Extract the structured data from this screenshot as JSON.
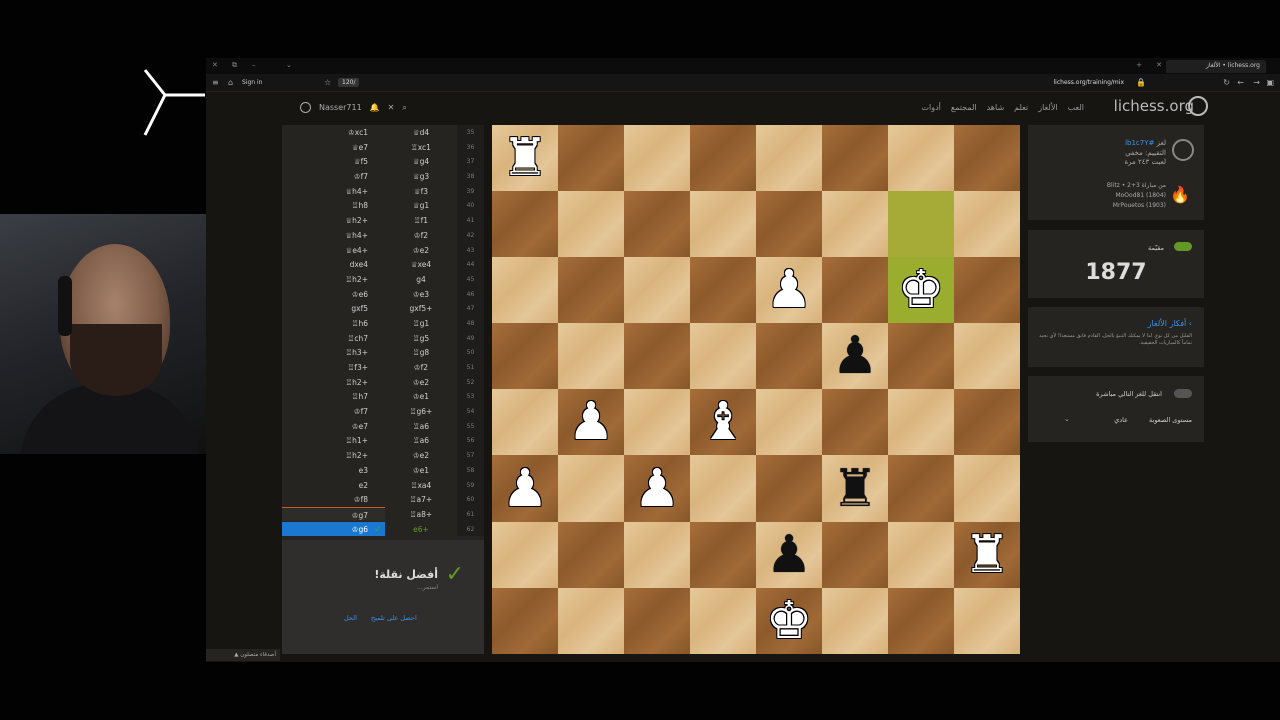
{
  "browser": {
    "tab_title": "lichess.org • الألغاز",
    "url": "lichess.org/training/mix",
    "signin": "Sign in",
    "chip": "120/"
  },
  "header": {
    "logo": "lichess.org",
    "nav": [
      "العب",
      "الألغاز",
      "تعلم",
      "شاهد",
      "المجتمع",
      "أدوات"
    ],
    "username": "Nasser711"
  },
  "moves": [
    {
      "n": "35",
      "w": "♕d4",
      "b": "♔xc1"
    },
    {
      "n": "36",
      "w": "♖xc1",
      "b": "♕e7"
    },
    {
      "n": "37",
      "w": "♕g4",
      "b": "♕f5"
    },
    {
      "n": "38",
      "w": "♕g3",
      "b": "♔f7"
    },
    {
      "n": "39",
      "w": "♕f3",
      "b": "♕h4+"
    },
    {
      "n": "40",
      "w": "♕g1",
      "b": "♖h8"
    },
    {
      "n": "41",
      "w": "♖f1",
      "b": "♕h2+"
    },
    {
      "n": "42",
      "w": "♔f2",
      "b": "♕h4+"
    },
    {
      "n": "43",
      "w": "♔e2",
      "b": "♕e4+"
    },
    {
      "n": "44",
      "w": "♕xe4",
      "b": "dxe4"
    },
    {
      "n": "45",
      "w": "g4",
      "b": "♖h2+"
    },
    {
      "n": "46",
      "w": "♔e3",
      "b": "♔e6"
    },
    {
      "n": "47",
      "w": "gxf5+",
      "b": "gxf5"
    },
    {
      "n": "48",
      "w": "♖g1",
      "b": "♖h6"
    },
    {
      "n": "49",
      "w": "♖g5",
      "b": "♖ch7"
    },
    {
      "n": "50",
      "w": "♖g8",
      "b": "♖h3+"
    },
    {
      "n": "51",
      "w": "♔f2",
      "b": "♖f3+"
    },
    {
      "n": "52",
      "w": "♔e2",
      "b": "♖h2+"
    },
    {
      "n": "53",
      "w": "♔e1",
      "b": "♖h7"
    },
    {
      "n": "54",
      "w": "♖g6+",
      "b": "♔f7"
    },
    {
      "n": "55",
      "w": "♖a6",
      "b": "♔e7"
    },
    {
      "n": "56",
      "w": "♖a6",
      "b": "♖h1+"
    },
    {
      "n": "57",
      "w": "♔e2",
      "b": "♖h2+"
    },
    {
      "n": "58",
      "w": "♔e1",
      "b": "e3"
    },
    {
      "n": "59",
      "w": "♖xa4",
      "b": "e2"
    },
    {
      "n": "60",
      "w": "♖a7+",
      "b": "♔f8"
    },
    {
      "n": "61",
      "w": "♖a8+",
      "b": "♔g7"
    },
    {
      "n": "62",
      "w": "e6+",
      "b": "♔g6"
    }
  ],
  "feedback": {
    "title": "أفضل نقلة!",
    "subtitle": "استمر...",
    "link_hint": "احصل على تلميح",
    "link_solution": "الحل"
  },
  "board": {
    "ranks": [
      [
        "wR",
        "",
        "",
        "",
        "",
        "",
        "",
        ""
      ],
      [
        "",
        "",
        "",
        "",
        "",
        "",
        "hl",
        ""
      ],
      [
        "",
        "",
        "",
        "",
        "wP",
        "",
        "wK*",
        ""
      ],
      [
        "",
        "",
        "",
        "",
        "",
        "bP",
        "",
        ""
      ],
      [
        "",
        "wP",
        "",
        "wB",
        "",
        "",
        "",
        ""
      ],
      [
        "wP",
        "",
        "wP",
        "",
        "",
        "bR",
        "",
        ""
      ],
      [
        "",
        "",
        "",
        "",
        "bP",
        "",
        "",
        "wR"
      ],
      [
        "",
        "",
        "",
        "",
        "wK",
        "",
        "",
        ""
      ]
    ]
  },
  "puzzle_info": {
    "puzzle_label": "لغز",
    "puzzle_id": "#lb1c7Y",
    "hidden_label": "التقييم:",
    "hidden_value": "مخفي",
    "played_label": "لعبت ٢٤٣ مرة",
    "game_line": "من مباراة Blitz • 2+3",
    "player1": "MoOod81 (1804)",
    "player2": "MrPouetos (1903)"
  },
  "rating_panel": {
    "label": "مقيّمة",
    "rating": "1877"
  },
  "themes_panel": {
    "title": "› أفكار الألغاز",
    "description": "القليل من كل نوع. لذا لا يمكنك التنبؤ بالحل، القادم فابق مستعدا! لأي نحيد تماماً كالمباريات الحقيقية."
  },
  "settings_panel": {
    "autonext": "انتقل للغز التالي مباشرة",
    "difficulty_label": "مستوى الصعوبة",
    "difficulty_value": "عادي"
  },
  "friends": "أصدقاء متصلون"
}
